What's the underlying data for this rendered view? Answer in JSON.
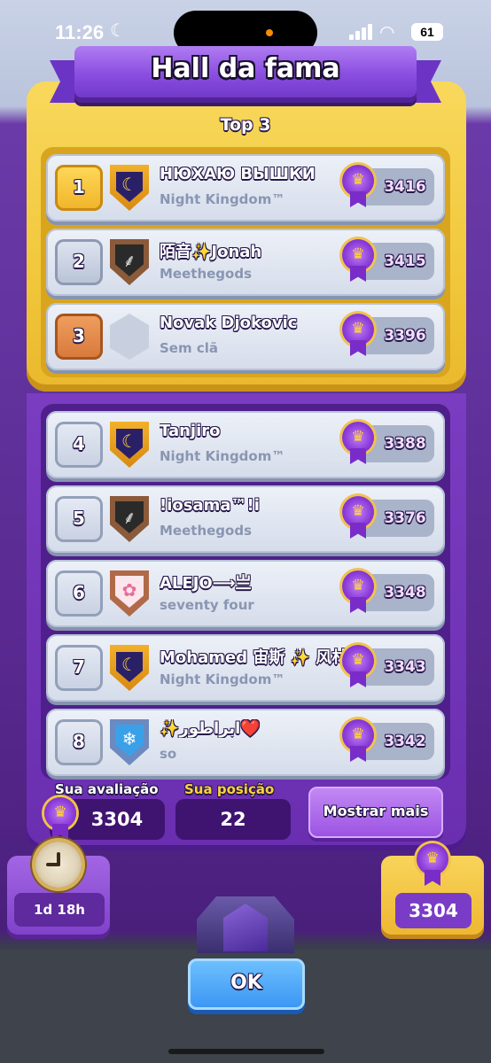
{
  "status_bar": {
    "time": "11:26",
    "battery": "61"
  },
  "title": "Hall da fama",
  "top3_label": "Top 3",
  "rows": [
    {
      "rank": "1",
      "name": "НЮХАЮ ВЫШКИ",
      "clan": "Night Kingdom™",
      "trophies": "3416",
      "badge": "castle-moon"
    },
    {
      "rank": "2",
      "name": "陌音✨Jonah",
      "clan": "Meethegods",
      "trophies": "3415",
      "badge": "bamboo"
    },
    {
      "rank": "3",
      "name": "Novak Djokovic",
      "clan": "Sem clã",
      "trophies": "3396",
      "badge": "empty"
    },
    {
      "rank": "4",
      "name": "Tanjiro",
      "clan": "Night Kingdom™",
      "trophies": "3388",
      "badge": "castle-moon"
    },
    {
      "rank": "5",
      "name": "!iosama™!i",
      "clan": "Meethegods",
      "trophies": "3376",
      "badge": "bamboo"
    },
    {
      "rank": "6",
      "name": "ALEJO⟶亗",
      "clan": "seventy four",
      "trophies": "3348",
      "badge": "flower"
    },
    {
      "rank": "7",
      "name": "Mohamed 宙斯 ✨ 风林",
      "clan": "Night Kingdom™",
      "trophies": "3343",
      "badge": "castle-moon"
    },
    {
      "rank": "8",
      "name": "✨ابراطور❤️",
      "clan": "so",
      "trophies": "3342",
      "badge": "snowflake"
    }
  ],
  "footer": {
    "rating_label": "Sua avaliação",
    "rating_value": "3304",
    "position_label": "Sua posição",
    "position_value": "22",
    "more_button": "Mostrar mais"
  },
  "timer": "1d 18h",
  "trophy_total": "3304",
  "ok_button": "OK",
  "colors": {
    "gold_panel": "#f2c83c",
    "purple_panel": "#6a2eb0",
    "ok_blue": "#3a94f2",
    "position_label": "#ffd23a"
  },
  "icons": {
    "trophy": "crown-medal-icon",
    "clock": "stopwatch-icon"
  }
}
